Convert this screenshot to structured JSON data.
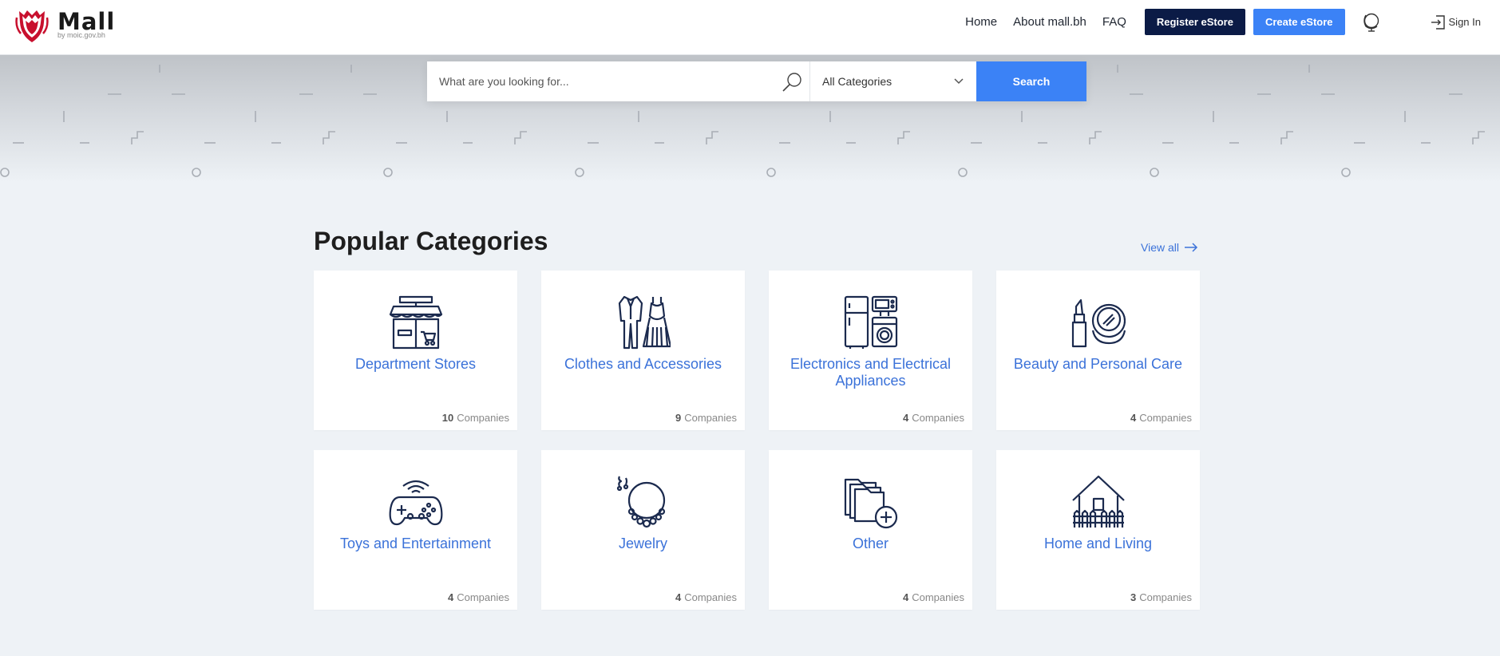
{
  "brand": {
    "title": "Mall",
    "subtitle": "by moic.gov.bh"
  },
  "nav": {
    "links": [
      "Home",
      "About mall.bh",
      "FAQ"
    ],
    "register_label": "Register eStore",
    "create_label": "Create eStore",
    "signin_label": "Sign In"
  },
  "search": {
    "placeholder": "What are you looking for...",
    "category_selected": "All Categories",
    "button_label": "Search"
  },
  "section": {
    "title": "Popular Categories",
    "view_all": "View all"
  },
  "categories": [
    {
      "name": "Department Stores",
      "count": "10",
      "unit": "Companies",
      "icon": "department-store-icon"
    },
    {
      "name": "Clothes and Accessories",
      "count": "9",
      "unit": "Companies",
      "icon": "clothes-icon"
    },
    {
      "name": "Electronics and Electrical Appliances",
      "count": "4",
      "unit": "Companies",
      "icon": "appliances-icon"
    },
    {
      "name": "Beauty and Personal Care",
      "count": "4",
      "unit": "Companies",
      "icon": "cosmetics-icon"
    },
    {
      "name": "Toys and Entertainment",
      "count": "4",
      "unit": "Companies",
      "icon": "gamepad-icon"
    },
    {
      "name": "Jewelry",
      "count": "4",
      "unit": "Companies",
      "icon": "necklace-icon"
    },
    {
      "name": "Other",
      "count": "4",
      "unit": "Companies",
      "icon": "folder-add-icon"
    },
    {
      "name": "Home and Living",
      "count": "3",
      "unit": "Companies",
      "icon": "house-icon"
    }
  ],
  "colors": {
    "accent": "#3b82f6",
    "dark": "#0b1b46",
    "link": "#3b72d9",
    "icon": "#1b2a4e"
  }
}
